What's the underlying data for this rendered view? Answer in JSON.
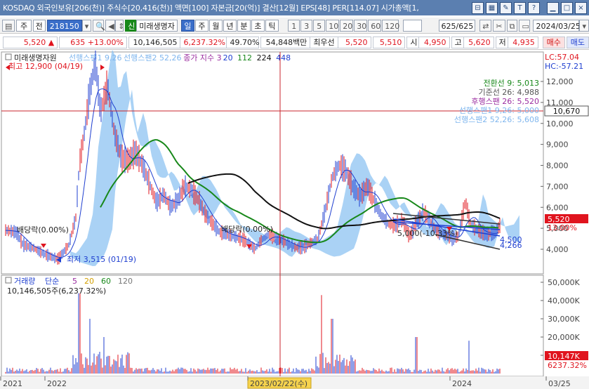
{
  "infobar": {
    "text": "KOSDAQ 외국인보유[206(천)] 주식수[20,416(천)] 액면[100] 자본금[20(억)] 결산[12월] EPS[48] PER[114.07] 시가총액[1,",
    "btn_q": "?"
  },
  "toolbar": {
    "code": "218150",
    "stock_name": "미래생명자",
    "prefix_letter": "신",
    "periods": [
      "일",
      "주",
      "월",
      "년",
      "분",
      "초",
      "틱"
    ],
    "selected_period": "일",
    "intervals": [
      "1",
      "3",
      "5",
      "10",
      "20",
      "30",
      "60",
      "120"
    ],
    "count": "625",
    "count_total": "/625",
    "date": "2024/03/25",
    "jeon": "전",
    "ju": "주"
  },
  "pricebar": {
    "price": "5,520",
    "change": "635",
    "change_pct": "+13.00%",
    "volume": "10,146,505",
    "volume_pct": "6,237.32%",
    "turnover": "49.70%",
    "amount": "54,848백만",
    "best_ask_label": "최우선",
    "best_ask": "5,520",
    "best_bid": "5,510",
    "open_label": "시",
    "open": "4,950",
    "high_label": "고",
    "high": "5,620",
    "low_label": "저",
    "low": "4,935",
    "buy": "매수",
    "sell": "매도"
  },
  "chart": {
    "legend_name": "미래생명자원",
    "legend_items": [
      {
        "label": "선행스팬1 9,26",
        "color": "#7fb6ee"
      },
      {
        "label": "선행스팬2 52,26",
        "color": "#7fb6ee"
      },
      {
        "label": "종가 지수 3",
        "color": "#9b2da0"
      },
      {
        "label": "20",
        "color": "#1f3fd0"
      },
      {
        "label": "112",
        "color": "#18881a"
      },
      {
        "label": "224",
        "color": "#111111"
      },
      {
        "label": "448",
        "color": "#1f3fd0"
      }
    ],
    "lc": "LC:57.04",
    "hc": "HC:-57.21",
    "high_note": "최고 12,900 (04/19)",
    "low_note": "최저 3,515 (01/19)",
    "no_div_1": "배당락(0.00%)",
    "no_div_2": "배당락(0.00%)",
    "ichimoku": [
      {
        "label": "전환선 9: 5,013",
        "color": "#18881a"
      },
      {
        "label": "기준선 26: 4,988",
        "color": "#555555"
      },
      {
        "label": "후행스팬 26: 5,520",
        "color": "#9b2da0"
      },
      {
        "label": "선행스팬1 9,26: 5,000",
        "color": "#7fb6ee"
      },
      {
        "label": "선행스팬2 52,26: 5,608",
        "color": "#7fb6ee"
      }
    ],
    "crosshair_price": "10,670",
    "current_price_tag": "5,520",
    "current_pct_tag": "13.00%",
    "yticks": [
      "12,000",
      "11,000",
      "10,000",
      "9,000",
      "8,000",
      "7,000",
      "6,000",
      "5,000",
      "4,000"
    ],
    "trend_labels": [
      "4,500",
      "4,266"
    ],
    "mid_label": "5,000(-10.33%)"
  },
  "volume_panel": {
    "title": "거래량",
    "ma_label": "단순",
    "ma": [
      {
        "label": "5",
        "color": "#9b2da0"
      },
      {
        "label": "20",
        "color": "#d4a000"
      },
      {
        "label": "60",
        "color": "#18881a"
      },
      {
        "label": "120",
        "color": "#777777"
      }
    ],
    "value_line": "10,146,505주(6,237.32%)",
    "yticks": [
      "50,000K",
      "40,000K",
      "30,000K",
      "20,000K",
      "10,000K"
    ],
    "vol_tag": "10,147K",
    "vol_pct_tag": "6237.32%"
  },
  "xaxis": {
    "labels": [
      "2021",
      "2022",
      "2023/02/22(수)",
      "2024",
      "03/25"
    ]
  }
}
